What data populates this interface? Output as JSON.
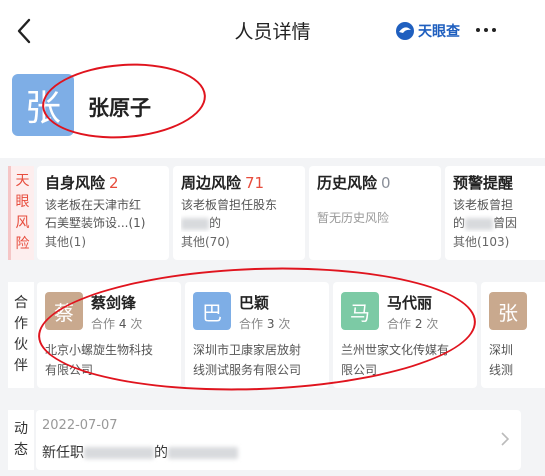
{
  "header": {
    "title": "人员详情",
    "brand": "天眼查"
  },
  "profile": {
    "avatar_char": "张",
    "name": "张原子"
  },
  "risk": {
    "section_label": [
      "天",
      "眼",
      "风",
      "险"
    ],
    "cards": [
      {
        "title": "自身风险",
        "count": "2",
        "desc1": "该老板在天津市红",
        "desc2": "石美墅装饰设...(1)",
        "other": "其他(1)"
      },
      {
        "title": "周边风险",
        "count": "71",
        "desc1": "该老板曾担任股东",
        "desc2_suffix": "的",
        "other": "其他(70)"
      },
      {
        "title": "历史风险",
        "count": "0",
        "desc_muted": "暂无历史风险"
      },
      {
        "title": "预警提醒",
        "desc1": "该老板曾担",
        "desc2_prefix": "的",
        "desc2_suffix": "曾因",
        "other": "其他(103)"
      }
    ]
  },
  "partners": {
    "section_label": [
      "合",
      "作",
      "伙",
      "伴"
    ],
    "items": [
      {
        "avatar_char": "蔡",
        "avatar_color": "#c9a98e",
        "name": "蔡剑锋",
        "coop_prefix": "合作",
        "coop_count": "4",
        "coop_suffix": "次",
        "company1": "北京小螺旋生物科技",
        "company2": "有限公司"
      },
      {
        "avatar_char": "巴",
        "avatar_color": "#7eaee6",
        "name": "巴颖",
        "coop_prefix": "合作",
        "coop_count": "3",
        "coop_suffix": "次",
        "company1": "深圳市卫康家居放射",
        "company2": "线测试服务有限公司"
      },
      {
        "avatar_char": "马",
        "avatar_color": "#7ccaa5",
        "name": "马代丽",
        "coop_prefix": "合作",
        "coop_count": "2",
        "coop_suffix": "次",
        "company1": "兰州世家文化传媒有",
        "company2": "限公司"
      },
      {
        "avatar_char": "张",
        "avatar_color": "#c9a98e",
        "company1": "深圳",
        "company2": "线测"
      }
    ]
  },
  "news": {
    "section_label": [
      "动",
      "态"
    ],
    "date": "2022-07-07",
    "text_prefix": "新任职",
    "text_mid": "的"
  }
}
